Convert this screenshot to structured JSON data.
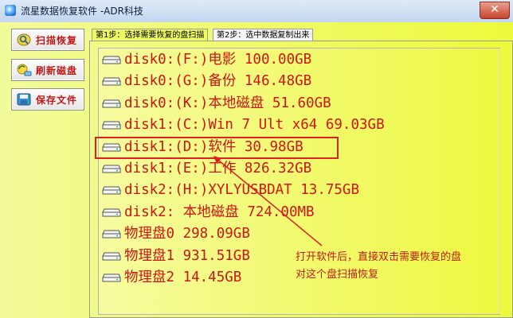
{
  "window": {
    "title": "流星数据恢复软件  -ADR科技",
    "close_label": "✕"
  },
  "sidebar": {
    "buttons": [
      {
        "label": "扫描恢复",
        "icon": "scan-icon"
      },
      {
        "label": "刷新磁盘",
        "icon": "refresh-disk-icon"
      },
      {
        "label": "保存文件",
        "icon": "save-file-icon"
      }
    ]
  },
  "tabs": [
    {
      "label": "第1步：选择需要恢复的盘扫描",
      "active": true
    },
    {
      "label": "第2步：选中数据复制出来",
      "active": false
    }
  ],
  "disks": [
    "disk0:(F:)电影 100.00GB",
    "disk0:(G:)备份 146.48GB",
    "disk0:(K:)本地磁盘 51.60GB",
    "disk1:(C:)Win 7 Ult x64 69.03GB",
    "disk1:(D:)软件 30.98GB",
    "disk1:(E:)工作 826.32GB",
    "disk2:(H:)XYLYUSBDAT 13.75GB",
    "disk2:    本地磁盘 724.00MB",
    "物理盘0 298.09GB",
    "物理盘1 931.51GB",
    "物理盘2 14.45GB"
  ],
  "annotation": {
    "line1": "打开软件后，直接双击需要恢复的盘",
    "line2": "对这个盘扫描恢复"
  },
  "colors": {
    "disk_text": "#d01414",
    "highlight": "#e02020",
    "panel_bg": "#eef840"
  }
}
